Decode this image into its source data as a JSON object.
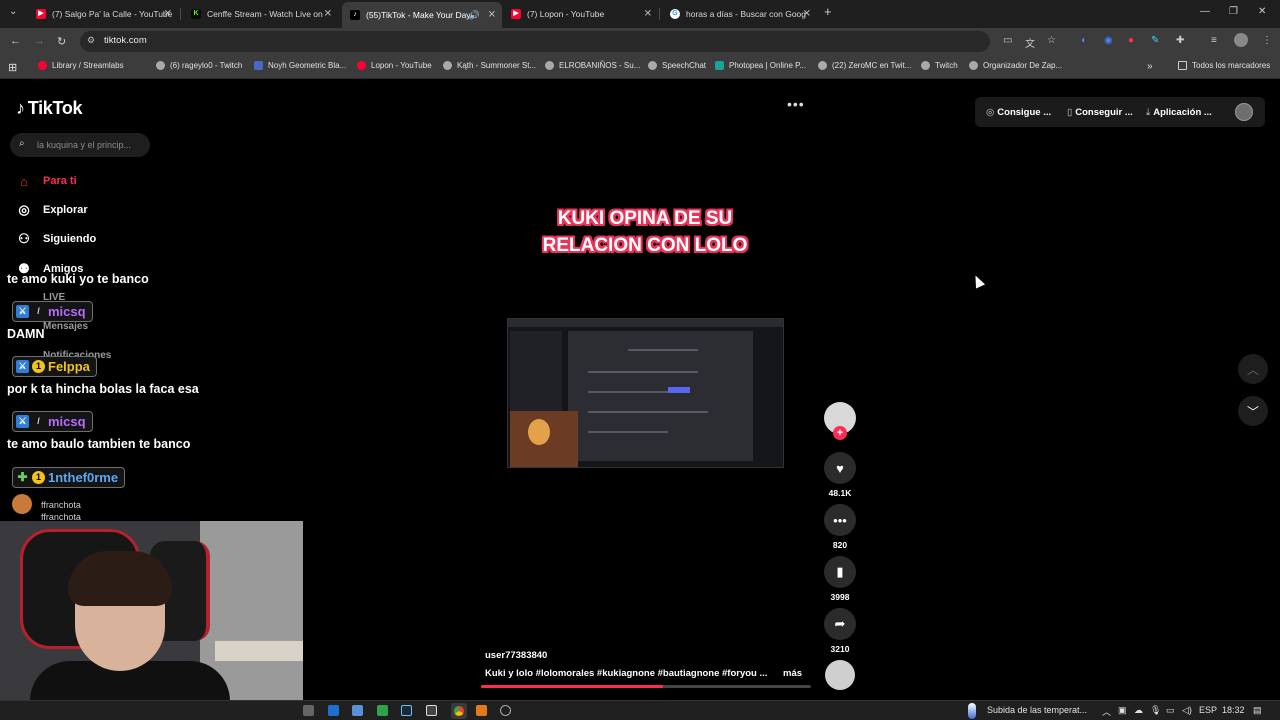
{
  "browser": {
    "tabs": [
      {
        "title": "(7) Salgo Pa' la Calle - YouTube",
        "icon": "youtube-icon",
        "color": "#ff0033"
      },
      {
        "title": "Cenffe Stream - Watch Live on",
        "icon": "kick-icon",
        "color": "#53fc18"
      },
      {
        "title": "(55)TikTok - Make Your Day",
        "icon": "tiktok-icon",
        "color": "#ffffff"
      },
      {
        "title": "(7) Lopon - YouTube",
        "icon": "youtube-icon",
        "color": "#ff0033"
      },
      {
        "title": "horas a días - Buscar con Goog",
        "icon": "google-icon",
        "color": "#4285f4"
      }
    ],
    "new_tab": "+",
    "url": "tiktok.com",
    "bookmarks": [
      "Library / Streamlabs",
      "(6) rageylo0 - Twitch",
      "Noyh Geometric Bla...",
      "Lopon - YouTube",
      "Kąth - Summoner St...",
      "ELROBANIÑOS - Su...",
      "SpeechChat",
      "Photopea | Online P...",
      "(22) ZeroMC en Twit...",
      "Twitch",
      "Organizador De Zap..."
    ],
    "bookmarks_overflow": "»",
    "all_bookmarks": "Todos los marcadores"
  },
  "tiktok": {
    "logo": "TikTok",
    "search_placeholder": "la kuquina y el princip...",
    "nav": {
      "for_you": "Para ti",
      "explore": "Explorar",
      "following": "Siguiendo",
      "friends": "Amigos"
    },
    "nav_hidden": {
      "live": "LIVE",
      "messages": "Mensajes",
      "notifications": "Notificaciones"
    },
    "header": {
      "more": "•••",
      "coins": "Consigue ...",
      "get": "Conseguir ...",
      "app": "Aplicación ..."
    },
    "video": {
      "title_line1": "KUKI OPINA DE SU",
      "title_line2": "RELACION CON LOLO",
      "user": "user77383840",
      "description": "Kuki y lolo #lolomorales  #kukiagnone  #bautiagnone  #foryou  ...",
      "more": "más",
      "progress": 0.55
    },
    "actions": {
      "likes": "48.1K",
      "comments": "820",
      "saves": "3998",
      "shares": "3210"
    }
  },
  "overlay": {
    "chat": [
      {
        "type": "msg",
        "text": "te amo kuki yo te banco"
      },
      {
        "type": "user",
        "name": "micsq",
        "color": "#b76bff",
        "badges": [
          "blue",
          "sword"
        ]
      },
      {
        "type": "msg",
        "text": "DAMN"
      },
      {
        "type": "user",
        "name": "Felppa",
        "color": "#f0c419",
        "badges": [
          "blue",
          "yel"
        ]
      },
      {
        "type": "msg",
        "text": "por k ta hincha bolas la faca esa"
      },
      {
        "type": "user",
        "name": "micsq",
        "color": "#b76bff",
        "badges": [
          "blue",
          "sword"
        ]
      },
      {
        "type": "msg",
        "text": "te amo baulo tambien te banco"
      },
      {
        "type": "user",
        "name": "1nthef0rme",
        "color": "#5aa9f5",
        "badges": [
          "grn",
          "yel"
        ]
      }
    ],
    "follower_name_1": "ffranchota",
    "follower_name_2": "ffranchota"
  },
  "taskbar": {
    "weather_text": "Subida de las temperat...",
    "language": "ESP",
    "time": "18:32"
  }
}
